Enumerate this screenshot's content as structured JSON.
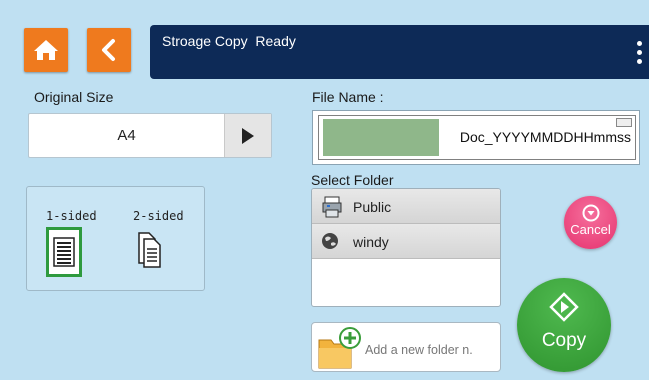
{
  "header": {
    "status_text": "Stroage Copy  Ready",
    "icons": [
      "home-icon",
      "back-icon",
      "more-vert-icon"
    ]
  },
  "original_size": {
    "label": "Original Size",
    "value": "A4"
  },
  "sides": {
    "one_sided_label": "1-sided",
    "two_sided_label": "2-sided",
    "selected": "1-sided"
  },
  "file_name": {
    "label": "File Name :",
    "value": "Doc_YYYYMMDDHHmmss"
  },
  "folder": {
    "label": "Select Folder",
    "items": [
      {
        "name": "Public",
        "icon": "printer-icon"
      },
      {
        "name": "windy",
        "icon": "user-globe-icon"
      }
    ]
  },
  "add_folder": {
    "label": "Add a new folder n."
  },
  "actions": {
    "cancel_label": "Cancel",
    "copy_label": "Copy"
  },
  "colors": {
    "background": "#bfe0f2",
    "nav_orange": "#ef7a1e",
    "status_bar": "#0d2a57",
    "cancel_pink": "#e6336f",
    "copy_green": "#2f942f",
    "selected_green": "#2e9a3e"
  }
}
